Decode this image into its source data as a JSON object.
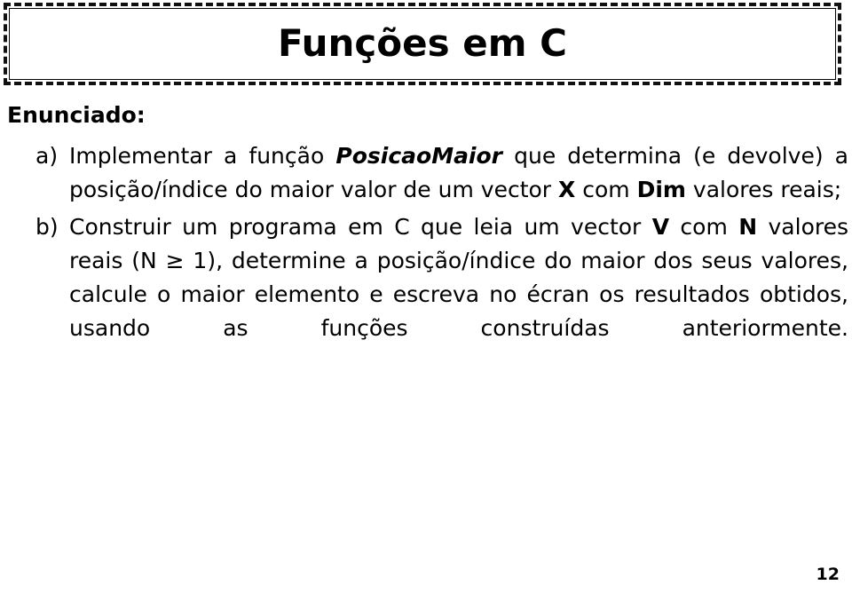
{
  "slide": {
    "title": "Funções em C",
    "page_number": "12",
    "colors": {
      "background": "#ffffff",
      "text": "#000000",
      "border": "#111111"
    }
  },
  "body": {
    "heading": "Enunciado:",
    "items": [
      {
        "marker": "a)",
        "segments": [
          {
            "text": "Implementar a função ",
            "style": "normal"
          },
          {
            "text": "PosicaoMaior",
            "style": "bold-italic"
          },
          {
            "text": " que determina (e devolve) a posição/índice do maior valor de um vector ",
            "style": "normal"
          },
          {
            "text": "X",
            "style": "bold"
          },
          {
            "text": " com ",
            "style": "normal"
          },
          {
            "text": "Dim",
            "style": "bold"
          },
          {
            "text": " valores reais;",
            "style": "normal"
          }
        ],
        "plain_text": "Implementar a função PosicaoMaior que determina (e devolve) a posição/índice do maior valor de um vector X com Dim valores reais;"
      },
      {
        "marker": "b)",
        "segments": [
          {
            "text": "Construir um programa em C que leia um vector ",
            "style": "normal"
          },
          {
            "text": "V",
            "style": "bold"
          },
          {
            "text": " com ",
            "style": "normal"
          },
          {
            "text": "N",
            "style": "bold"
          },
          {
            "text": " valores reais (N ≥ 1), determine a posição/índice do maior dos seus valores, calcule o maior elemento e escreva no écran os resultados obtidos, usando as funções construídas anteriormente.",
            "style": "normal"
          }
        ],
        "plain_text": "Construir um programa em C que leia um vector V com N valores reais (N ≥ 1), determine a posição/índice do maior dos seus valores, calcule o maior elemento e escreva no écran os resultados obtidos, usando as funções construídas anteriormente."
      }
    ]
  }
}
